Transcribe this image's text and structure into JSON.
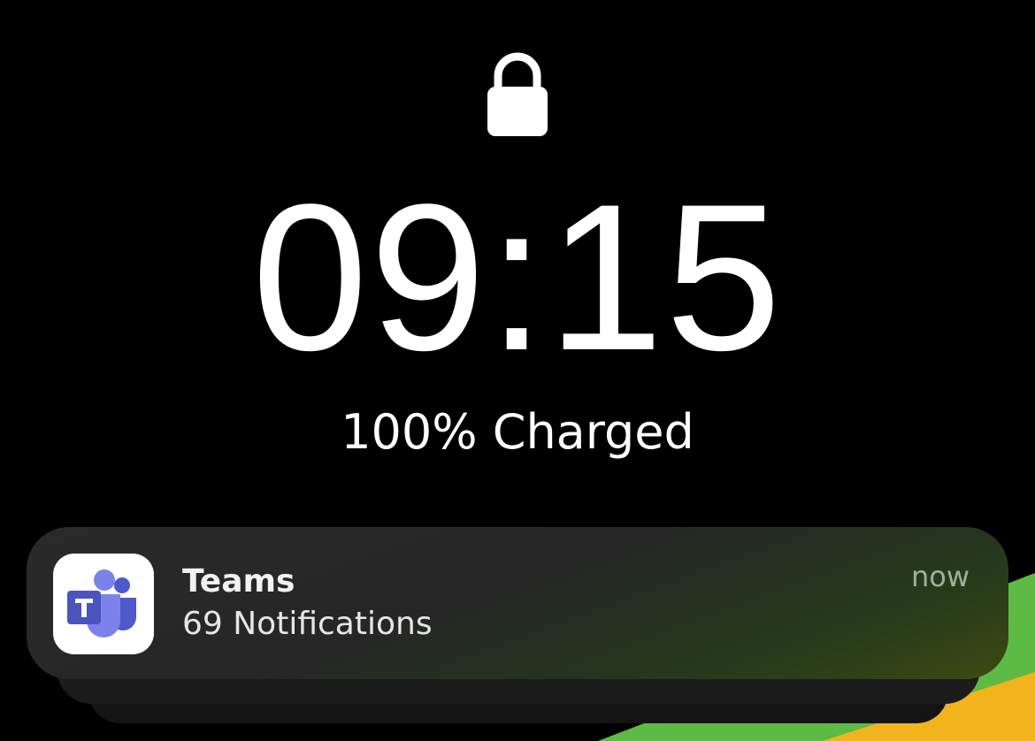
{
  "lock_screen": {
    "time": "09:15",
    "battery_status": "100% Charged"
  },
  "notification": {
    "app_name": "Teams",
    "message": "69 Notifications",
    "timestamp": "now",
    "icon": "microsoft-teams-icon"
  },
  "colors": {
    "background": "#000000",
    "wallpaper_green": "#5dba45",
    "wallpaper_yellow": "#f2b41c",
    "teams_purple": "#5b5fc7"
  }
}
